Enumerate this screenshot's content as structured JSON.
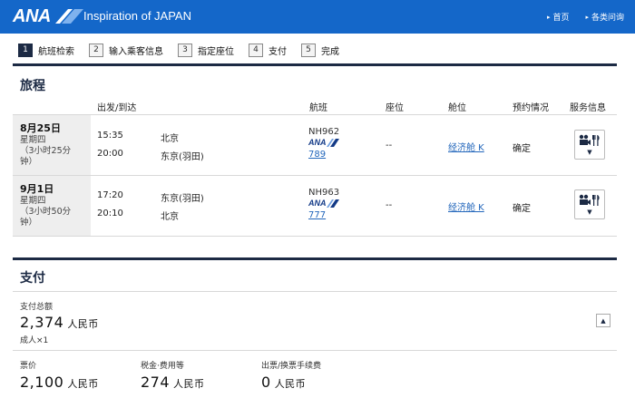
{
  "header": {
    "brand": "ANA",
    "tagline": "Inspiration of JAPAN",
    "links": [
      "首页",
      "各类问询"
    ],
    "link_arrow": "▸"
  },
  "steps": [
    {
      "num": "1",
      "label": "航班检索",
      "active": true
    },
    {
      "num": "2",
      "label": "输入乘客信息",
      "active": false
    },
    {
      "num": "3",
      "label": "指定座位",
      "active": false
    },
    {
      "num": "4",
      "label": "支付",
      "active": false
    },
    {
      "num": "5",
      "label": "完成",
      "active": false
    }
  ],
  "itinerary": {
    "title": "旅程",
    "columns": {
      "depart_arrive": "出发/到达",
      "flight": "航班",
      "seat": "座位",
      "cabin": "舱位",
      "booking_status": "预约情况",
      "services": "服务信息"
    },
    "segments": [
      {
        "date": "8月25日",
        "weekday": "星期四",
        "duration_line1": "（3小时25分",
        "duration_line2": "钟）",
        "dep_time": "15:35",
        "dep_city": "北京",
        "arr_time": "20:00",
        "arr_city": "东京(羽田)",
        "flight_no": "NH962",
        "airline": "ANA",
        "aircraft": "789",
        "seat": "--",
        "cabin": "经济舱 K",
        "status": "确定"
      },
      {
        "date": "9月1日",
        "weekday": "星期四",
        "duration_line1": "（3小时50分",
        "duration_line2": "钟）",
        "dep_time": "17:20",
        "dep_city": "东京(羽田)",
        "arr_time": "20:10",
        "arr_city": "北京",
        "flight_no": "NH963",
        "airline": "ANA",
        "aircraft": "777",
        "seat": "--",
        "cabin": "经济舱 K",
        "status": "确定"
      }
    ],
    "service_icons": [
      "video-camera-icon",
      "fork-knife-icon"
    ],
    "dropdown_glyph": "▼"
  },
  "payment": {
    "title": "支付",
    "total_label": "支付总额",
    "total_amount": "2,374",
    "currency": "人民币",
    "pax": "成人×1",
    "collapse_glyph": "▲",
    "items": [
      {
        "label": "票价",
        "amount": "2,100"
      },
      {
        "label": "税金·费用等",
        "amount": "274"
      },
      {
        "label": "出票/换票手续费",
        "amount": "0"
      }
    ]
  },
  "colors": {
    "header_blue": "#1467c9",
    "navy": "#1c2a44",
    "link_blue": "#2266bb"
  }
}
